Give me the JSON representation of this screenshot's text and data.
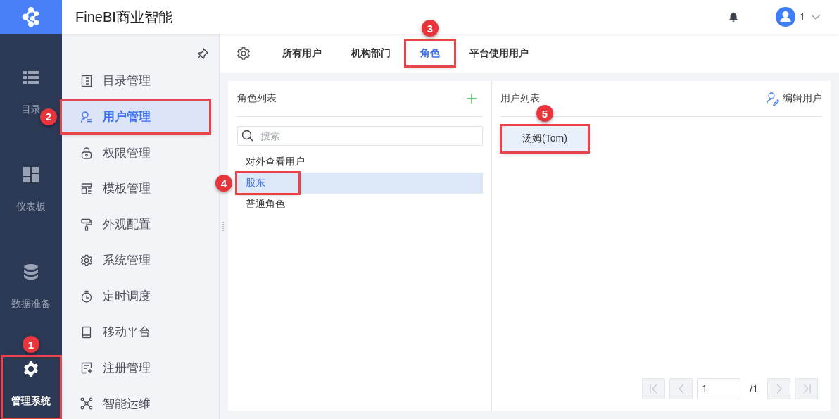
{
  "header": {
    "title": "FineBI商业智能",
    "user_name": "1"
  },
  "rail": {
    "items": [
      {
        "kind": "list",
        "label": "目录",
        "selected": false
      },
      {
        "kind": "dashboard",
        "label": "仪表板",
        "selected": false
      },
      {
        "kind": "database",
        "label": "数据准备",
        "selected": false
      },
      {
        "kind": "gear",
        "label": "管理系统",
        "selected": true,
        "callout": {
          "number": "1",
          "kind": "top"
        }
      }
    ]
  },
  "sidebar": {
    "items": [
      {
        "kind": "catalog",
        "label": "目录管理",
        "selected": false
      },
      {
        "kind": "user",
        "label": "用户管理",
        "selected": true,
        "callout": {
          "number": "2",
          "kind": "left"
        }
      },
      {
        "kind": "lock",
        "label": "权限管理",
        "selected": false
      },
      {
        "kind": "template",
        "label": "模板管理",
        "selected": false
      },
      {
        "kind": "brush",
        "label": "外观配置",
        "selected": false
      },
      {
        "kind": "gear",
        "label": "系统管理",
        "selected": false
      },
      {
        "kind": "timer",
        "label": "定时调度",
        "selected": false
      },
      {
        "kind": "mobile",
        "label": "移动平台",
        "selected": false
      },
      {
        "kind": "register",
        "label": "注册管理",
        "selected": false
      },
      {
        "kind": "network",
        "label": "智能运维",
        "selected": false
      }
    ]
  },
  "tabs": [
    {
      "label": "所有用户",
      "selected": false
    },
    {
      "label": "机构部门",
      "selected": false
    },
    {
      "label": "角色",
      "selected": true,
      "callout": {
        "number": "3",
        "kind": "top"
      }
    },
    {
      "label": "平台使用用户",
      "selected": false
    }
  ],
  "role_panel": {
    "title": "角色列表",
    "search": {
      "placeholder": "搜索"
    },
    "roles": [
      {
        "label": "对外查看用户",
        "selected": false
      },
      {
        "label": "股东",
        "selected": true,
        "callout": {
          "number": "4",
          "kind": "left"
        }
      },
      {
        "label": "普通角色",
        "selected": false
      }
    ]
  },
  "user_panel": {
    "title": "用户列表",
    "edit_action": "编辑用户",
    "users": [
      {
        "label": "汤姆(Tom)",
        "callout": {
          "number": "5",
          "kind": "top"
        }
      }
    ],
    "pagination": {
      "page": "1",
      "total": "/1",
      "buttons": [
        {
          "kind": "first",
          "disabled": true
        },
        {
          "kind": "prev",
          "disabled": true
        },
        {
          "kind": "next",
          "disabled": true
        },
        {
          "kind": "last",
          "disabled": true
        }
      ]
    }
  }
}
